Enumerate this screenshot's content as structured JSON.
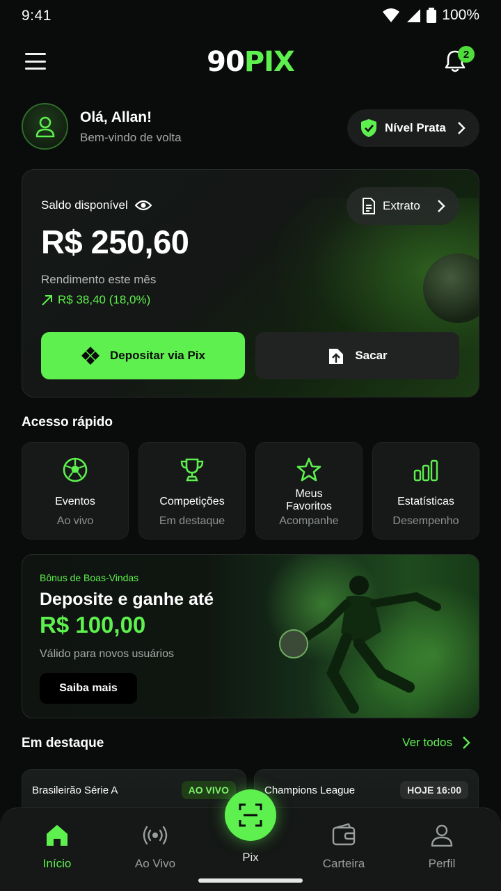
{
  "status": {
    "time": "9:41",
    "battery": "100%"
  },
  "header": {
    "logo_white": "90",
    "logo_green": "PIX",
    "notifications_count": "2"
  },
  "greeting": {
    "title": "Olá, Allan!",
    "subtitle": "Bem-vindo de volta",
    "level": "Nível Prata"
  },
  "balance": {
    "label": "Saldo disponível",
    "value": "R$ 250,60",
    "yield_label": "Rendimento este mês",
    "yield_value": "R$ 38,40 (18,0%)",
    "statement_label": "Extrato",
    "deposit_label": "Depositar via Pix",
    "withdraw_label": "Sacar"
  },
  "quick_access": {
    "title": "Acesso rápido",
    "items": [
      {
        "title": "Eventos",
        "subtitle": "Ao vivo",
        "icon": "soccer-ball-icon"
      },
      {
        "title": "Competições",
        "subtitle": "Em destaque",
        "icon": "trophy-icon"
      },
      {
        "title": "Meus Favoritos",
        "subtitle": "Acompanhe",
        "icon": "star-icon"
      },
      {
        "title": "Estatísticas",
        "subtitle": "Desempenho",
        "icon": "bar-chart-icon"
      }
    ]
  },
  "promo": {
    "tag": "Bônus de Boas-Vindas",
    "title": "Deposite e ganhe até",
    "amount": "R$ 100,00",
    "subtitle": "Válido para novos usuários",
    "button": "Saiba mais"
  },
  "featured": {
    "title": "Em destaque",
    "see_all": "Ver todos",
    "matches": [
      {
        "league": "Brasileirão Série A",
        "badge": "AO VIVO"
      },
      {
        "league": "Champions League",
        "badge": "HOJE 16:00"
      }
    ]
  },
  "nav": {
    "home": "Início",
    "live": "Ao Vivo",
    "pix": "Pix",
    "wallet": "Carteira",
    "profile": "Perfil"
  },
  "colors": {
    "accent": "#5ef04f",
    "background": "#0a0c0b",
    "card": "#161918"
  }
}
